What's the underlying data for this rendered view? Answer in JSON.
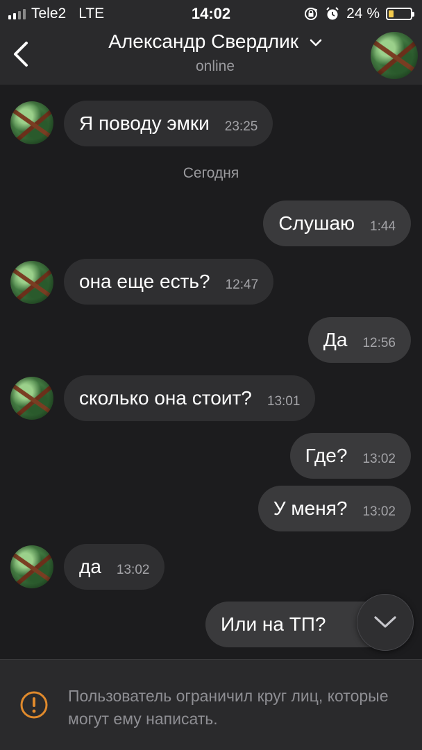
{
  "status_bar": {
    "carrier": "Tele2",
    "network": "LTE",
    "time": "14:02",
    "battery_percent": "24 %",
    "battery_level": 0.24
  },
  "header": {
    "title": "Александр Свердлик",
    "status": "online"
  },
  "messages": [
    {
      "text": "Я поводу эмки",
      "time": "23:25"
    },
    {
      "text": "Слушаю",
      "time": "1:44"
    },
    {
      "text": "она еще есть?",
      "time": "12:47"
    },
    {
      "text": "Да",
      "time": "12:56"
    },
    {
      "text": "сколько она стоит?",
      "time": "13:01"
    },
    {
      "text": "Где?",
      "time": "13:02"
    },
    {
      "text": "У меня?",
      "time": "13:02"
    },
    {
      "text": "да",
      "time": "13:02"
    },
    {
      "text": "Или на ТП?",
      "time": ""
    }
  ],
  "date_separator": "Сегодня",
  "notice": {
    "text": "Пользователь ограничил круг лиц, которые могут ему написать."
  },
  "colors": {
    "background": "#1c1c1e",
    "incoming_bubble": "#2f2f31",
    "outgoing_bubble": "#3a3a3c",
    "warning": "#e08a2c",
    "battery": "#f2c94c"
  }
}
